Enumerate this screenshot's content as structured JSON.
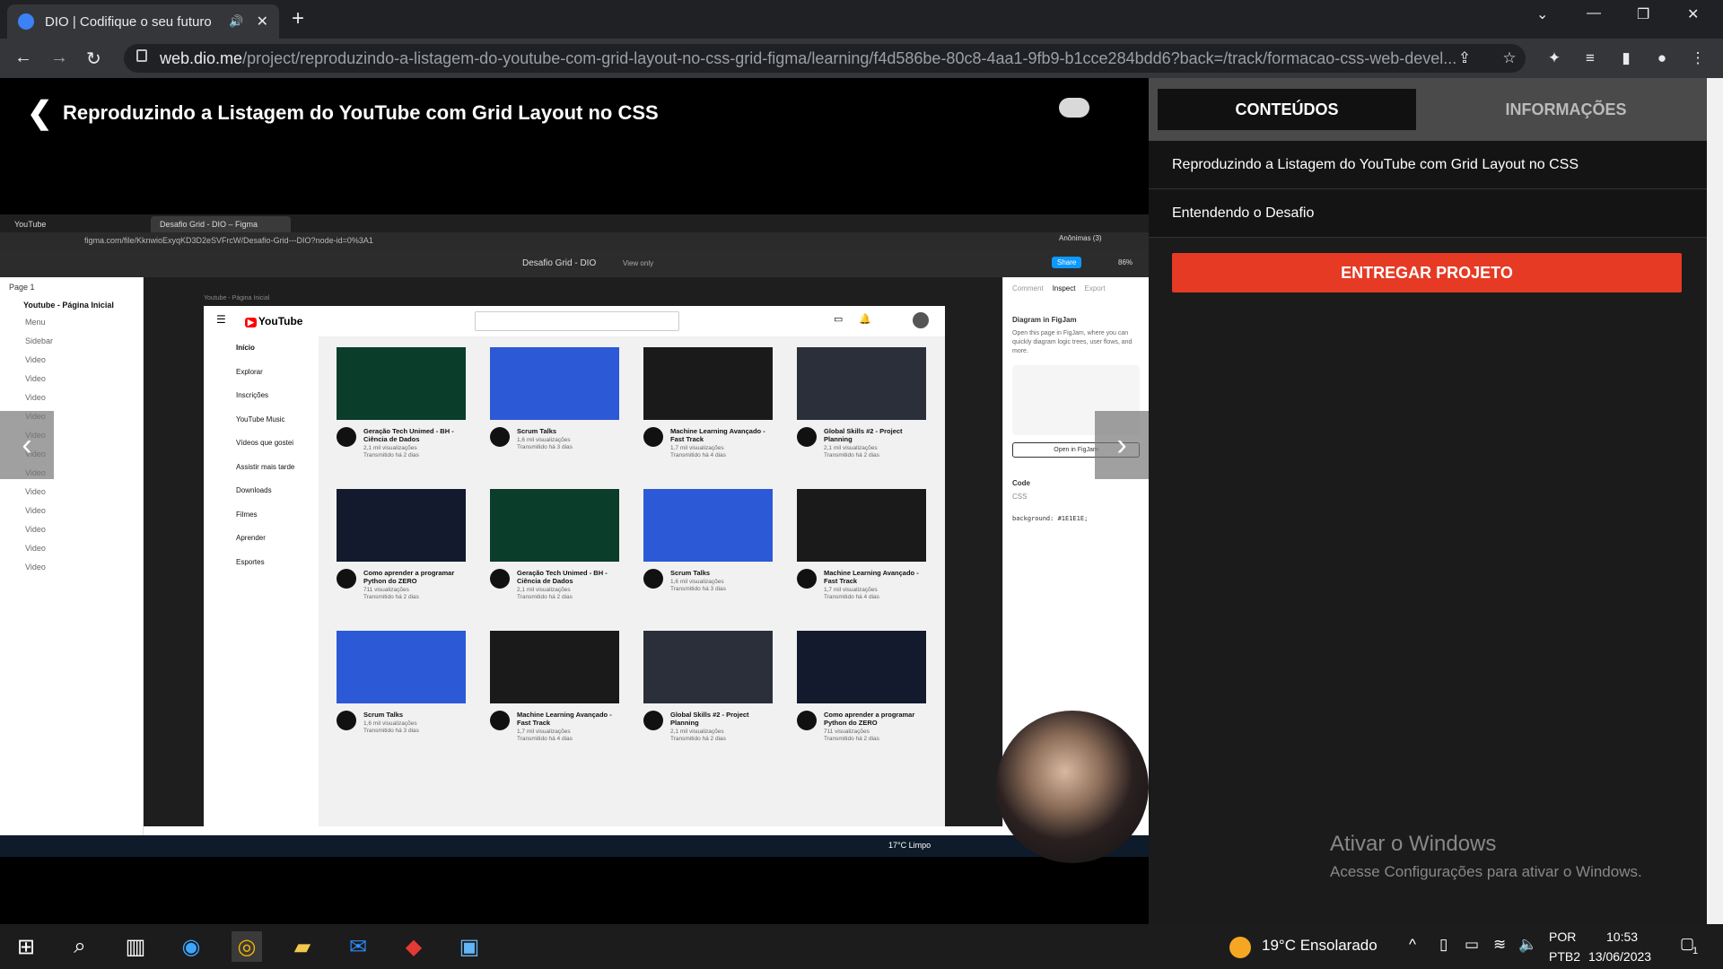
{
  "browser": {
    "tab_title": "DIO | Codifique o seu futuro",
    "url_host": "web.dio.me",
    "url_path": "/project/reproduzindo-a-listagem-do-youtube-com-grid-layout-no-css-grid-figma/learning/f4d586be-80c8-4aa1-9fb9-b1cce284bdd6?back=/track/formacao-css-web-devel..."
  },
  "page": {
    "title": "Reproduzindo a Listagem do YouTube com Grid Layout no CSS"
  },
  "video": {
    "inner_tabs": [
      "YouTube",
      "Desafio Grid - DIO – Figma"
    ],
    "inner_url": "figma.com/file/KknwioExyqKD3D2eSVFrcW/Desafio-Grid---DIO?node-id=0%3A1",
    "figma_title": "Desafio Grid - DIO",
    "figma_view": "View only",
    "figma_share": "Share",
    "figma_zoom": "86%",
    "figma_user": "Anônimas (3)",
    "page_label": "Page 1",
    "layers_root": "Youtube - Página Inicial",
    "layers": [
      "Menu",
      "Sidebar",
      "Video",
      "Video",
      "Video",
      "Video",
      "Video",
      "Video",
      "Video",
      "Video",
      "Video",
      "Video",
      "Video",
      "Video"
    ],
    "frame_label": "Youtube - Página Inicial",
    "yt_logo": "YouTube",
    "sidebar": [
      "Início",
      "Explorar",
      "Inscrições",
      "YouTube Music",
      "Vídeos que gostei",
      "Assistir mais tarde",
      "Downloads",
      "Filmes",
      "Aprender",
      "Esportes"
    ],
    "cards": [
      {
        "title": "Geração Tech Unimed - BH - Ciência de Dados",
        "views": "2,1 mil visualizações",
        "when": "Transmitido há 2 dias",
        "color": "#0a3d2a"
      },
      {
        "title": "Scrum Talks",
        "views": "1,6 mil visualizações",
        "when": "Transmitido há 3 dias",
        "color": "#2c59d6"
      },
      {
        "title": "Machine Learning Avançado - Fast Track",
        "views": "1,7 mil visualizações",
        "when": "Transmitido há 4 dias",
        "color": "#1a1a1a"
      },
      {
        "title": "Global Skills #2 - Project Planning",
        "views": "2,1 mil visualizações",
        "when": "Transmitido há 2 dias",
        "color": "#2a2f3a"
      },
      {
        "title": "Como aprender a programar Python do ZERO",
        "views": "711 visualizações",
        "when": "Transmitido há 2 dias",
        "color": "#141a2e"
      },
      {
        "title": "Geração Tech Unimed - BH - Ciência de Dados",
        "views": "2,1 mil visualizações",
        "when": "Transmitido há 2 dias",
        "color": "#0a3d2a"
      },
      {
        "title": "Scrum Talks",
        "views": "1,6 mil visualizações",
        "when": "Transmitido há 3 dias",
        "color": "#2c59d6"
      },
      {
        "title": "Machine Learning Avançado - Fast Track",
        "views": "1,7 mil visualizações",
        "when": "Transmitido há 4 dias",
        "color": "#1a1a1a"
      },
      {
        "title": "Scrum Talks",
        "views": "1,6 mil visualizações",
        "when": "Transmitido há 3 dias",
        "color": "#2c59d6"
      },
      {
        "title": "Machine Learning Avançado - Fast Track",
        "views": "1,7 mil visualizações",
        "when": "Transmitido há 4 dias",
        "color": "#1a1a1a"
      },
      {
        "title": "Global Skills #2 - Project Planning",
        "views": "2,1 mil visualizações",
        "when": "Transmitido há 2 dias",
        "color": "#2a2f3a"
      },
      {
        "title": "Como aprender a programar Python do ZERO",
        "views": "711 visualizações",
        "when": "Transmitido há 2 dias",
        "color": "#141a2e"
      }
    ],
    "inspect_tabs": [
      "Comment",
      "Inspect",
      "Export"
    ],
    "figjam_title": "Diagram in FigJam",
    "figjam_text": "Open this page in FigJam, where you can quickly diagram logic trees, user flows, and more.",
    "figjam_btn": "Open in FigJam",
    "code_label": "Code",
    "code_lang": "CSS",
    "code_line": "background: #1E1E1E;",
    "inner_weather": "17°C Limpo"
  },
  "sidebar_right": {
    "tab_active": "CONTEÚDOS",
    "tab_inactive": "INFORMAÇÕES",
    "items": [
      "Reproduzindo a Listagem do YouTube com Grid Layout no CSS",
      "Entendendo o Desafio"
    ],
    "cta": "ENTREGAR PROJETO",
    "activate_title": "Ativar o Windows",
    "activate_sub": "Acesse Configurações para ativar o Windows."
  },
  "taskbar": {
    "weather": "19°C Ensolarado",
    "lang1": "POR",
    "lang2": "PTB2",
    "time": "10:53",
    "date": "13/06/2023",
    "notif": "1"
  },
  "colors": {
    "accent": "#e63a24",
    "sidebar_bg": "#1b1b1b"
  }
}
